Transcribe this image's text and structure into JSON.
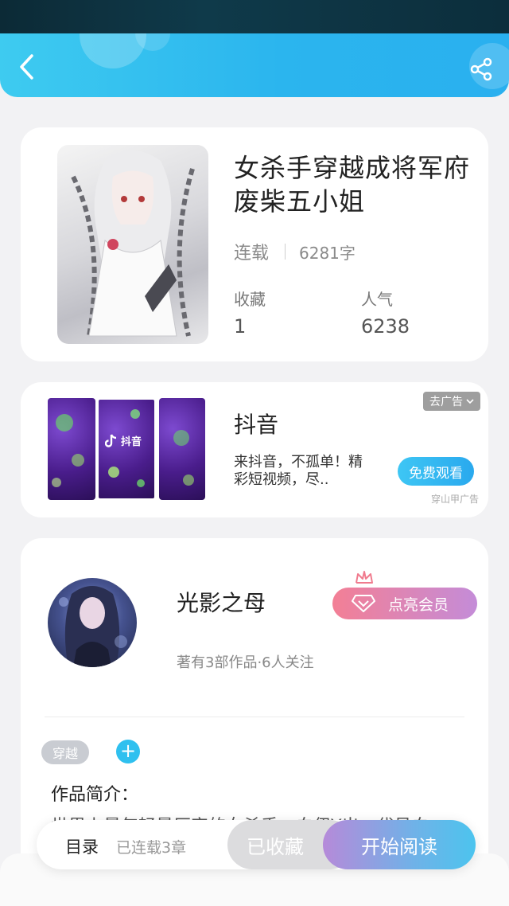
{
  "header": {
    "back_icon": "chevron-left-icon",
    "share_icon": "share-icon"
  },
  "book": {
    "title": "女杀手穿越成将军府废柴五小姐",
    "status": "连载",
    "word_count": "6281字",
    "stats": [
      {
        "label": "收藏",
        "value": "1"
      },
      {
        "label": "人气",
        "value": "6238"
      }
    ]
  },
  "ad": {
    "title": "抖音",
    "image_logo": "抖音",
    "description": "来抖音，不孤单！精彩短视频，尽..",
    "remove_label": "去广告",
    "button_label": "免费观看",
    "source": "穿山甲广告"
  },
  "author": {
    "name": "光影之母",
    "meta": "著有3部作品·6人关注",
    "vip_label": "点亮会员"
  },
  "tags": [
    {
      "label": "穿越"
    }
  ],
  "intro": {
    "title": "作品简介：",
    "text": "世界上最年轻最厉害的女杀手，白伊Y出，代号白"
  },
  "bottom_bar": {
    "toc_label": "目录",
    "toc_count": "已连载3章",
    "collected_label": "已收藏",
    "read_label": "开始阅读"
  },
  "colors": {
    "accent": "#2bb5ee",
    "vip_start": "#f37f95",
    "vip_end": "#c48cd8"
  }
}
